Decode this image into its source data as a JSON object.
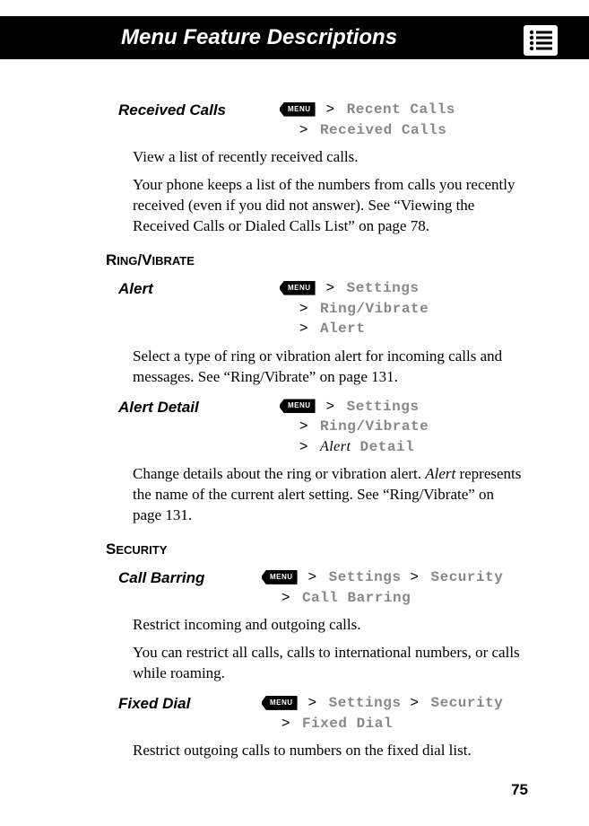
{
  "header": {
    "title": "Menu Feature Descriptions"
  },
  "menu_key": "MENU",
  "gt": ">",
  "sections": {
    "received_calls": {
      "title": "Received Calls",
      "path_l1": "Recent Calls",
      "path_l2": "Received Calls",
      "body1": "View a list of recently received calls.",
      "body2": "Your phone keeps a list of the numbers from calls you recently received (even if you did not answer). See “Viewing the Received Calls or Dialed Calls List” on page 78."
    },
    "ring_vibrate": {
      "heading": {
        "p1": "R",
        "p2": "ING",
        "p3": "/V",
        "p4": "IBRATE"
      }
    },
    "alert": {
      "title": "Alert",
      "path_l1": "Settings",
      "path_l2": "Ring/Vibrate",
      "path_l3": "Alert",
      "body1": "Select a type of ring or vibration alert for incoming calls and messages. See “Ring/Vibrate” on page 131."
    },
    "alert_detail": {
      "title": "Alert Detail",
      "path_l1": "Settings",
      "path_l2": "Ring/Vibrate",
      "path_l3_italic": "Alert",
      "path_l3_mono": " Detail",
      "body1_pre": "Change details about the ring or vibration alert. ",
      "body1_italic": "Alert",
      "body1_post": " represents the name of the current alert setting. See “Ring/Vibrate” on page 131."
    },
    "security": {
      "heading": {
        "p1": "S",
        "p2": "ECURITY"
      }
    },
    "call_barring": {
      "title": "Call Barring",
      "path_l1a": "Settings",
      "path_l1b": "Security",
      "path_l2": "Call Barring",
      "body1": "Restrict incoming and outgoing calls.",
      "body2": "You can restrict all calls, calls to international numbers, or calls while roaming."
    },
    "fixed_dial": {
      "title": "Fixed Dial",
      "path_l1a": "Settings",
      "path_l1b": "Security",
      "path_l2": "Fixed Dial",
      "body1": "Restrict outgoing calls to numbers on the fixed dial list."
    }
  },
  "page_number": "75"
}
